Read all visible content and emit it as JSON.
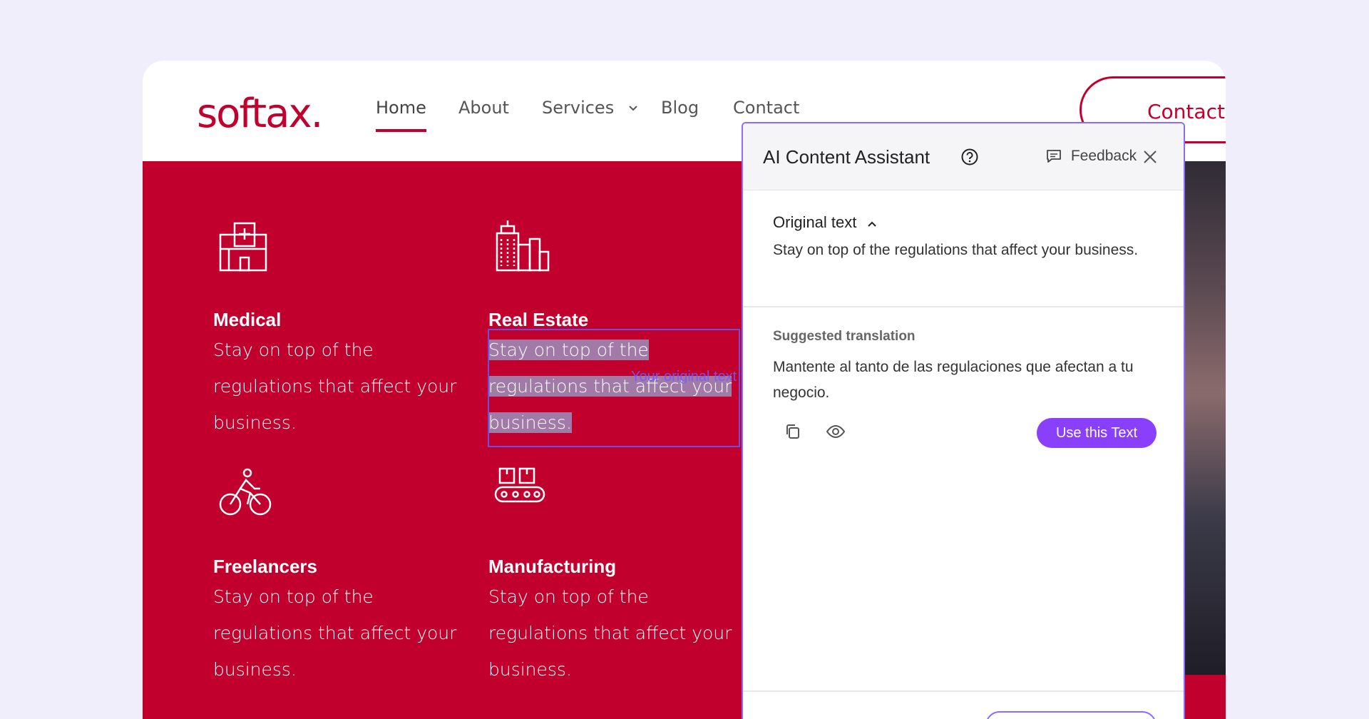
{
  "site": {
    "logo": "softax.",
    "nav": [
      {
        "label": "Home"
      },
      {
        "label": "About"
      },
      {
        "label": "Services"
      },
      {
        "label": "Blog"
      },
      {
        "label": "Contact"
      }
    ],
    "contact_button": "Contact",
    "brand_color": "#c1002d"
  },
  "cards": [
    {
      "title": "Medical",
      "text": "Stay on top of the regulations that affect your business.",
      "icon": "hospital-icon"
    },
    {
      "title": "Real Estate",
      "text": "Stay on top of the regulations that affect your business.",
      "icon": "buildings-icon"
    },
    {
      "title": "Freelancers",
      "text": "Stay on top of the regulations that affect your business.",
      "icon": "cyclist-icon"
    },
    {
      "title": "Manufacturing",
      "text": "Stay on top of the regulations that affect your business.",
      "icon": "conveyor-icon"
    }
  ],
  "selection": {
    "label": "Your original text",
    "text_line1": "Stay on top of the",
    "text_line2": "regulations that affect your",
    "text_line3": "business."
  },
  "panel": {
    "title": "AI Content Assistant",
    "feedback": "Feedback",
    "original_title": "Original text",
    "original_text": "Stay on top of the regulations that affect your business.",
    "suggested_title": "Suggested translation",
    "suggested_text": "Mantente al tanto de las regulaciones que afectan a tu negocio.",
    "use_button": "Use this Text",
    "accent_color": "#8a3ffc"
  }
}
